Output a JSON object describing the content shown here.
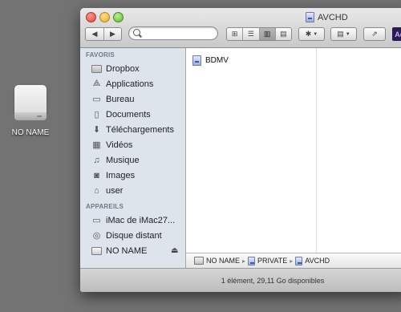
{
  "desktop": {
    "drive_label": "NO NAME"
  },
  "window": {
    "title": "AVCHD"
  },
  "toolbar": {
    "back_icon": "back-arrow",
    "forward_icon": "forward-arrow",
    "search_placeholder": "",
    "view_modes": [
      "icon-view",
      "list-view",
      "column-view",
      "coverflow-view"
    ],
    "active_view": "column-view",
    "action_icon": "gear-icon",
    "arrange_icon": "arrange-icon",
    "share_icon": "share-icon",
    "app_badge": "Ae"
  },
  "sidebar": {
    "favorites_heading": "FAVORIS",
    "favorites": [
      {
        "label": "Dropbox",
        "icon": "folder-icon"
      },
      {
        "label": "Applications",
        "icon": "applications-icon"
      },
      {
        "label": "Bureau",
        "icon": "desktop-icon"
      },
      {
        "label": "Documents",
        "icon": "documents-icon"
      },
      {
        "label": "Téléchargements",
        "icon": "downloads-icon"
      },
      {
        "label": "Vidéos",
        "icon": "movies-icon"
      },
      {
        "label": "Musique",
        "icon": "music-icon"
      },
      {
        "label": "Images",
        "icon": "pictures-icon"
      },
      {
        "label": "user",
        "icon": "home-icon"
      }
    ],
    "devices_heading": "APPAREILS",
    "devices": [
      {
        "label": "iMac de iMac27...",
        "icon": "imac-icon"
      },
      {
        "label": "Disque distant",
        "icon": "remote-disc-icon"
      },
      {
        "label": "NO NAME",
        "icon": "external-drive-icon"
      }
    ]
  },
  "content": {
    "items": [
      {
        "name": "BDMV"
      }
    ]
  },
  "pathbar": {
    "segments": [
      "NO NAME",
      "PRIVATE",
      "AVCHD"
    ],
    "separator": "▸"
  },
  "statusbar": {
    "text": "1 élément, 29,11 Go disponibles"
  }
}
